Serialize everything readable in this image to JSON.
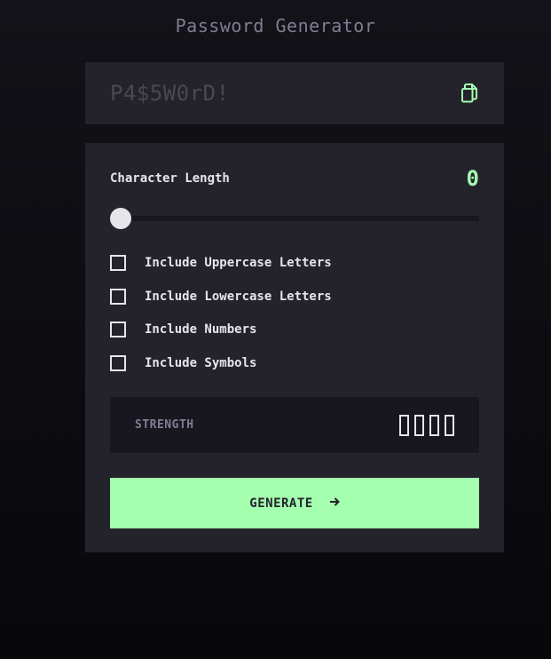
{
  "app": {
    "title": "Password Generator"
  },
  "output": {
    "password_placeholder": "P4$5W0rD!",
    "copy_icon": "copy-icon"
  },
  "length": {
    "label": "Character Length",
    "value": "0",
    "slider_fraction": 0
  },
  "options": [
    {
      "label": "Include Uppercase Letters",
      "checked": false
    },
    {
      "label": "Include Lowercase Letters",
      "checked": false
    },
    {
      "label": "Include Numbers",
      "checked": false
    },
    {
      "label": "Include Symbols",
      "checked": false
    }
  ],
  "strength": {
    "label": "STRENGTH",
    "filled_bars": 0,
    "total_bars": 4
  },
  "generate": {
    "label": "GENERATE",
    "icon": "arrow-right-icon"
  },
  "colors": {
    "accent": "#a4ffaf",
    "panel": "#24232c",
    "inset": "#18171f",
    "text": "#e6e5ea",
    "muted": "#817d92"
  }
}
